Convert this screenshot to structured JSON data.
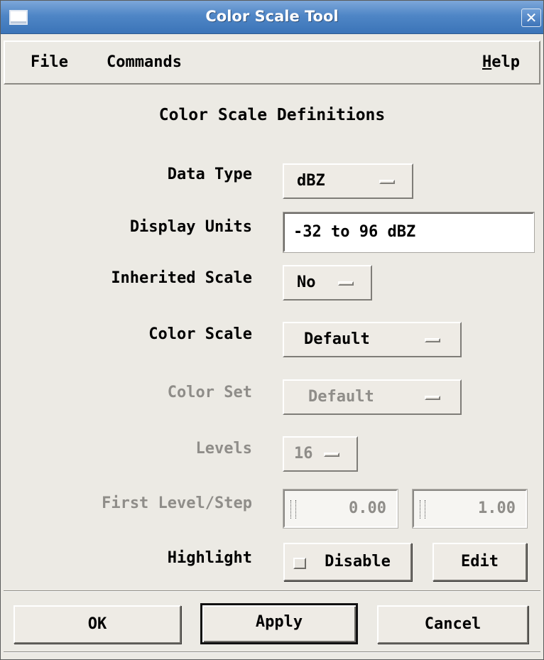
{
  "window": {
    "title": "Color Scale Tool",
    "close_glyph": "✕"
  },
  "menubar": {
    "file": "File",
    "commands": "Commands",
    "help_mnemonic": "H",
    "help_rest": "elp"
  },
  "heading": "Color Scale Definitions",
  "fields": {
    "data_type": {
      "label": "Data Type",
      "value": "dBZ"
    },
    "display_units": {
      "label": "Display Units",
      "value": "-32 to 96 dBZ"
    },
    "inherited_scale": {
      "label": "Inherited Scale",
      "value": "No"
    },
    "color_scale": {
      "label": "Color Scale",
      "value": "Default"
    },
    "color_set": {
      "label": "Color Set",
      "value": "Default"
    },
    "levels": {
      "label": "Levels",
      "value": "16"
    },
    "first_level_step": {
      "label": "First Level/Step",
      "first": "0.00",
      "step": "1.00"
    },
    "highlight": {
      "label": "Highlight",
      "toggle_label": "Disable",
      "edit_label": "Edit"
    }
  },
  "buttons": {
    "ok": "OK",
    "apply": "Apply",
    "cancel": "Cancel"
  },
  "colors": {
    "titlebar": "#4f86c6",
    "background": "#eceae4",
    "disabled_text": "#8f8d89"
  }
}
